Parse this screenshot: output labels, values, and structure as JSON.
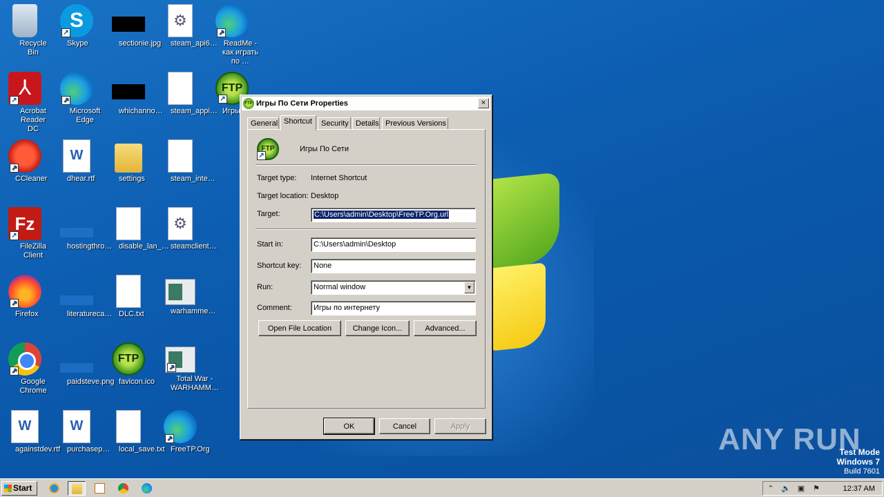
{
  "desktop": {
    "icons": [
      {
        "label": "Recycle Bin"
      },
      {
        "label": "Skype"
      },
      {
        "label": "sectionie.jpg"
      },
      {
        "label": "steam_api6…"
      },
      {
        "label": "ReadMe - как играть по …"
      },
      {
        "label": "Acrobat Reader DC"
      },
      {
        "label": "Microsoft Edge"
      },
      {
        "label": "whichanno…"
      },
      {
        "label": "steam_appi…"
      },
      {
        "label": "Игры По"
      },
      {
        "label": "CCleaner"
      },
      {
        "label": "dhear.rtf"
      },
      {
        "label": "settings"
      },
      {
        "label": "steam_inte…"
      },
      {
        "label": "FileZilla Client"
      },
      {
        "label": "hostingthro…"
      },
      {
        "label": "disable_lan_…"
      },
      {
        "label": "steamclient…"
      },
      {
        "label": "Firefox"
      },
      {
        "label": "literatureca…"
      },
      {
        "label": "DLC.txt"
      },
      {
        "label": "warhamme…"
      },
      {
        "label": "Google Chrome"
      },
      {
        "label": "paidsteve.png"
      },
      {
        "label": "favicon.ico"
      },
      {
        "label": "Total War - WARHAMM…"
      },
      {
        "label": "againstdev.rtf"
      },
      {
        "label": "purchasep…"
      },
      {
        "label": "local_save.txt"
      },
      {
        "label": "FreeTP.Org"
      }
    ],
    "watermark": "ANY RUN",
    "test_mode": {
      "line1": "Test Mode",
      "line2": "Windows 7",
      "line3": "Build 7601"
    }
  },
  "dialog": {
    "title": "Игры По Сети Properties",
    "close_glyph": "×",
    "tabs": [
      {
        "label": "General",
        "active": false
      },
      {
        "label": "Shortcut",
        "active": true
      },
      {
        "label": "Security",
        "active": false
      },
      {
        "label": "Details",
        "active": false
      },
      {
        "label": "Previous Versions",
        "active": false
      }
    ],
    "shortcut_name": "Игры По Сети",
    "target_type_label": "Target type:",
    "target_type_value": "Internet Shortcut",
    "target_location_label": "Target location:",
    "target_location_value": "Desktop",
    "target_label": "Target:",
    "target_value": "C:\\Users\\admin\\Desktop\\FreeTP.Org.url",
    "start_in_label": "Start in:",
    "start_in_value": "C:\\Users\\admin\\Desktop",
    "shortcut_key_label": "Shortcut key:",
    "shortcut_key_value": "None",
    "run_label": "Run:",
    "run_value": "Normal window",
    "comment_label": "Comment:",
    "comment_value": "Игры по интернету",
    "open_file_location": "Open File Location",
    "change_icon": "Change Icon...",
    "advanced": "Advanced...",
    "ok": "OK",
    "cancel": "Cancel",
    "apply": "Apply"
  },
  "taskbar": {
    "start_label": "Start",
    "clock": "12:37 AM",
    "colors": {
      "accent": "#0a246a",
      "face": "#d4d0c8"
    }
  }
}
